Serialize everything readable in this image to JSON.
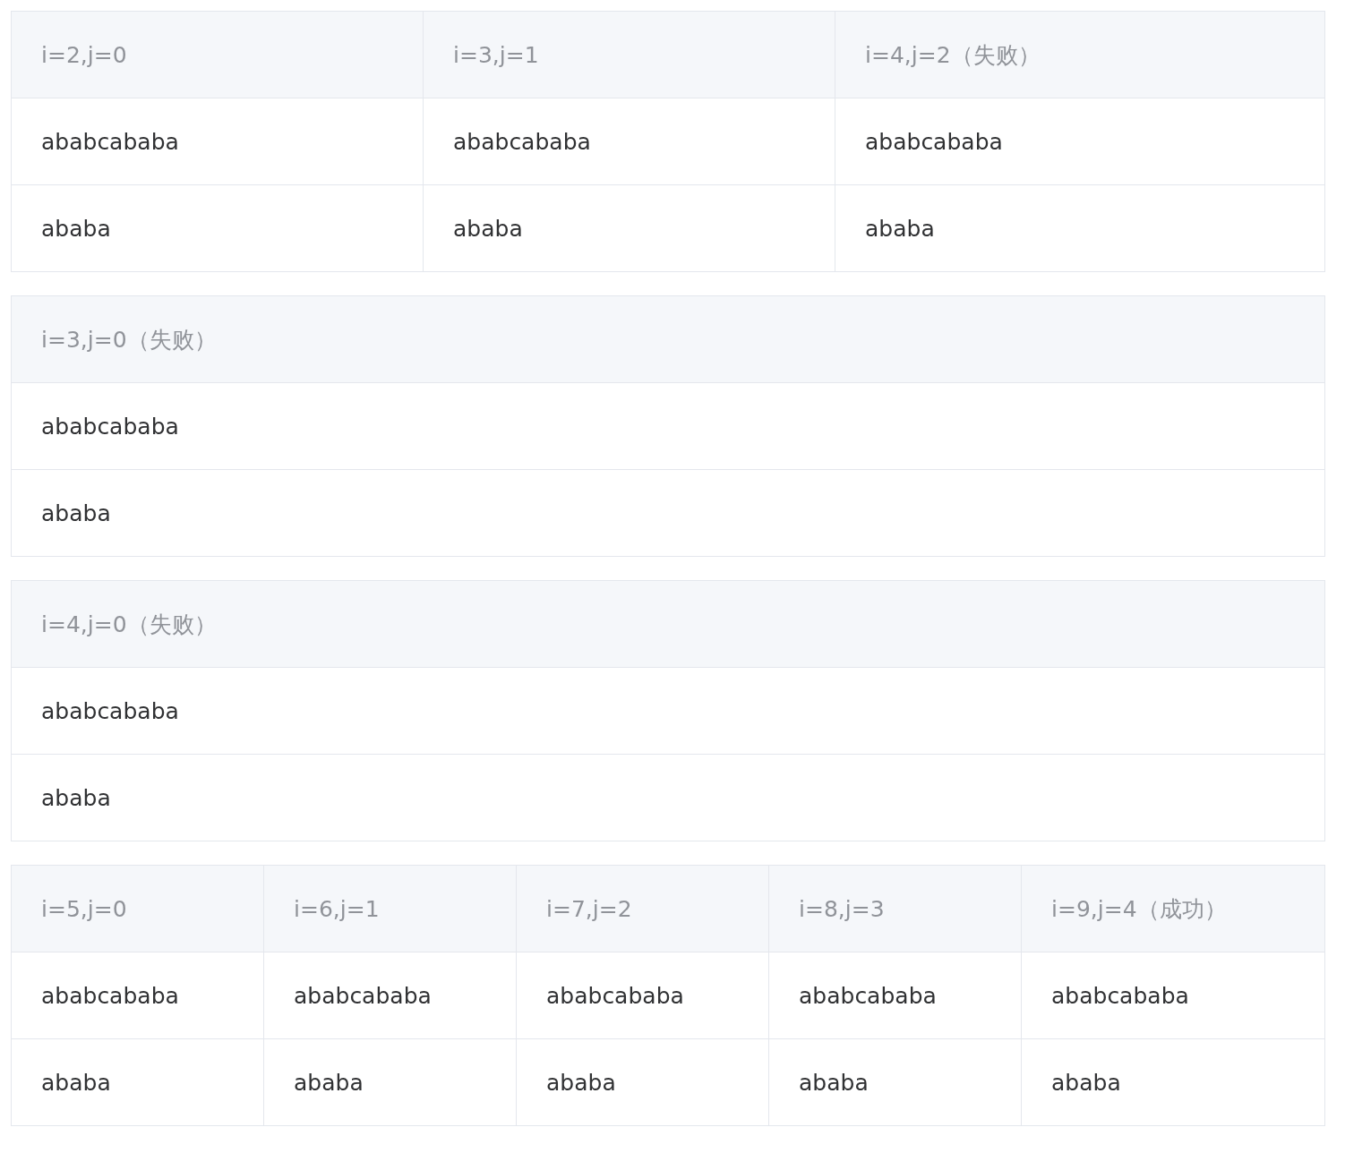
{
  "tables": [
    {
      "columns": [
        "i=2,j=0",
        "i=3,j=1",
        "i=4,j=2（失败）"
      ],
      "rows": [
        [
          "ababcababa",
          "ababcababa",
          "ababcababa"
        ],
        [
          "ababa",
          "ababa",
          "ababa"
        ]
      ]
    },
    {
      "columns": [
        "i=3,j=0（失败）"
      ],
      "rows": [
        [
          "ababcababa"
        ],
        [
          "ababa"
        ]
      ]
    },
    {
      "columns": [
        "i=4,j=0（失败）"
      ],
      "rows": [
        [
          "ababcababa"
        ],
        [
          "ababa"
        ]
      ]
    },
    {
      "columns": [
        "i=5,j=0",
        "i=6,j=1",
        "i=7,j=2",
        "i=8,j=3",
        "i=9,j=4（成功）"
      ],
      "rows": [
        [
          "ababcababa",
          "ababcababa",
          "ababcababa",
          "ababcababa",
          "ababcababa"
        ],
        [
          "ababa",
          "ababa",
          "ababa",
          "ababa",
          "ababa"
        ]
      ]
    }
  ]
}
